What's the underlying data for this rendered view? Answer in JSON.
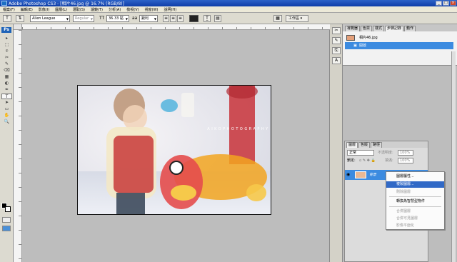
{
  "window": {
    "title": "Adobe Photoshop CS3 - [相片46.jpg @ 16.7% (RGB/8)]",
    "buttons": [
      "_",
      "□",
      "×"
    ]
  },
  "menubar": {
    "items": [
      "檔案(F)",
      "編輯(E)",
      "影像(I)",
      "圖層(L)",
      "選取(S)",
      "濾鏡(T)",
      "分析(A)",
      "檢視(V)",
      "視窗(W)",
      "說明(H)"
    ]
  },
  "options": {
    "tool_icon": "T",
    "font_family": "Alien League",
    "font_style": "Regular",
    "font_size": "36.33 點",
    "anti_alias": "銳利",
    "warp_icon": "T̲",
    "workspace_label": "工作區 ▾"
  },
  "tools": {
    "logo": "Ps",
    "items": [
      "▸",
      "⬚",
      "⌾",
      "✂",
      "✎",
      "⌫",
      "▦",
      "◐",
      "✒",
      "T",
      "➤",
      "▭",
      "✋",
      "🔍"
    ]
  },
  "document": {
    "filename": "相片46.jpg",
    "watermark": "AIKOPHOTOGRAPHY"
  },
  "history_panel": {
    "tabs": [
      "導覽器",
      "色票",
      "樣式",
      "步驟記錄",
      "動作"
    ],
    "snapshot_label": "相片46.jpg",
    "open_step_label": "開啟"
  },
  "layers_panel": {
    "tabs": [
      "圖層",
      "色版",
      "路徑"
    ],
    "blend_mode": "正常",
    "opacity_label": "不透明度:",
    "opacity_value": "100%",
    "lock_label": "鎖定:",
    "fill_label": "填滿:",
    "fill_value": "100%",
    "layer_name": "背景"
  },
  "context_menu": {
    "items": [
      {
        "label": "圖層屬性...",
        "disabled": false,
        "hover": false
      },
      {
        "label": "複製圖層...",
        "disabled": false,
        "hover": true
      },
      {
        "label": "刪除圖層",
        "disabled": true,
        "hover": false
      },
      {
        "label": "轉換為智慧型物件",
        "disabled": false,
        "hover": false
      },
      {
        "label": "合併圖層",
        "disabled": true,
        "hover": false
      },
      {
        "label": "合併可見圖層",
        "disabled": true,
        "hover": false
      },
      {
        "label": "影像平面化",
        "disabled": true,
        "hover": false
      }
    ]
  },
  "colors": {
    "titlebar": "#1f4fb8",
    "selection": "#3c8be0",
    "menu_hover": "#3169c6"
  }
}
